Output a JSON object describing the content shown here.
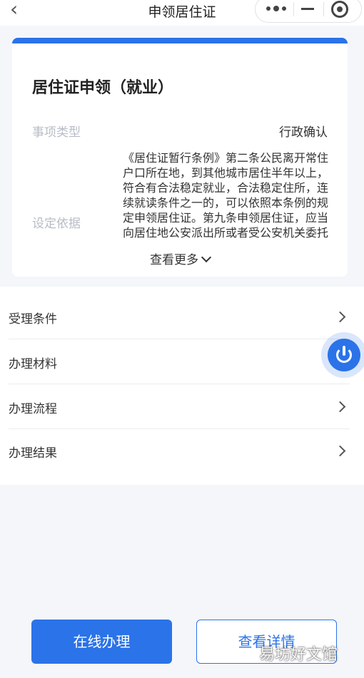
{
  "nav": {
    "title": "申领居住证",
    "back_icon": "chevron-left-icon"
  },
  "card": {
    "title": "居住证申领（就业）",
    "accent_color": "#2b73e8",
    "fields": [
      {
        "label": "事项类型",
        "value": "行政确认"
      },
      {
        "label": "设定依据",
        "value": "《居住证暂行条例》第二条公民离开常住户口所在地，到其他城市居住半年以上，符合有合法稳定就业，合法稳定住所，连续就读条件之一的，可以依照本条例的规定申领居住证。第九条申领居住证，应当向居住地公安派出所或者受公安机关委托的社区服"
      }
    ],
    "more_label": "查看更多"
  },
  "list": {
    "items": [
      {
        "label": "受理条件"
      },
      {
        "label": "办理材料"
      },
      {
        "label": "办理流程"
      },
      {
        "label": "办理结果"
      }
    ]
  },
  "float_button": {
    "icon": "power-icon"
  },
  "footer": {
    "primary_label": "在线办理",
    "secondary_label": "查看详情"
  },
  "watermark": "易坊好文馆"
}
